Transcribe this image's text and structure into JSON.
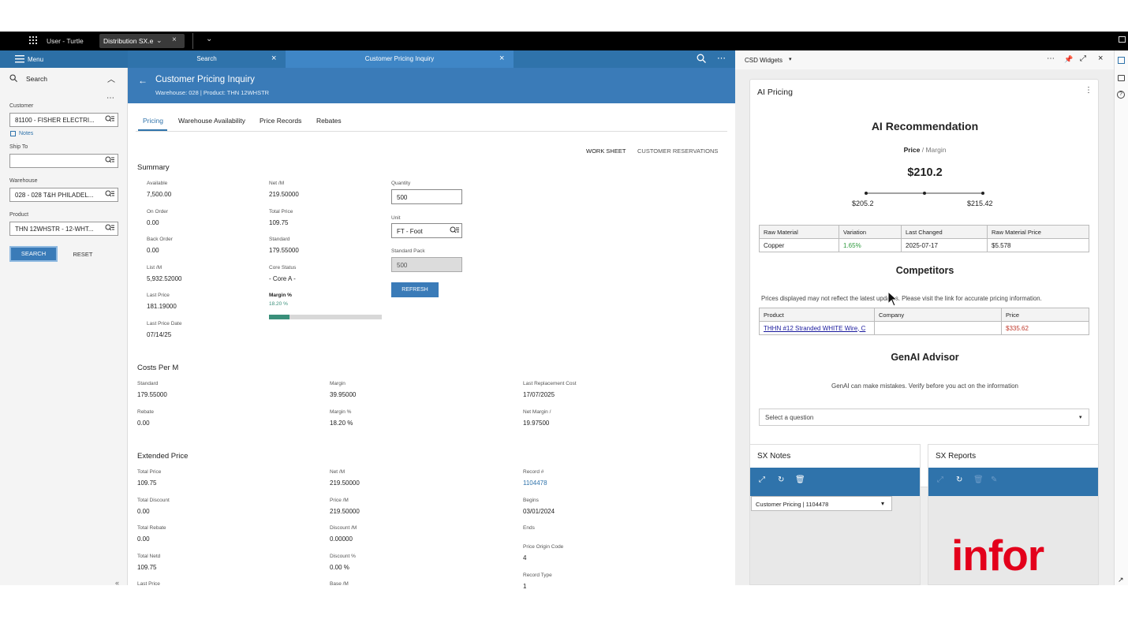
{
  "topbar": {
    "user": "User - Turtle",
    "app": "Distribution SX.e"
  },
  "menu": {
    "label": "Menu"
  },
  "tabs": [
    {
      "label": "Search"
    },
    {
      "label": "Customer Pricing Inquiry"
    }
  ],
  "search_panel": {
    "title": "Search",
    "customer_label": "Customer",
    "customer_value": "81100 - FISHER ELECTRI...",
    "notes_label": "Notes",
    "shipto_label": "Ship To",
    "shipto_value": "",
    "warehouse_label": "Warehouse",
    "warehouse_value": "028 - 028 T&H PHILADEL...",
    "product_label": "Product",
    "product_value": "THN 12WHSTR - 12-WHT...",
    "search_btn": "SEARCH",
    "reset_btn": "RESET"
  },
  "header": {
    "title": "Customer Pricing Inquiry",
    "subtitle": "Warehouse: 028 | Product: THN 12WHSTR"
  },
  "subtabs": [
    "Pricing",
    "Warehouse Availability",
    "Price Records",
    "Rebates"
  ],
  "actions": {
    "worksheet": "WORK SHEET",
    "reservations": "CUSTOMER RESERVATIONS"
  },
  "summary": {
    "title": "Summary",
    "available_label": "Available",
    "available": "7,500.00",
    "on_order_label": "On Order",
    "on_order": "0.00",
    "back_order_label": "Back Order",
    "back_order": "0.00",
    "list_label": "List /M",
    "list": "5,932.52000",
    "last_price_label": "Last Price",
    "last_price": "181.19000",
    "last_price_date_label": "Last Price Date",
    "last_price_date": "07/14/25",
    "net_label": "Net /M",
    "net": "219.50000",
    "total_price_label": "Total Price",
    "total_price": "109.75",
    "standard_label": "Standard",
    "standard": "179.55000",
    "core_status_label": "Core Status",
    "core_status": "- Core A -",
    "margin_label": "Margin %",
    "margin": "18.20 %",
    "margin_fraction": 0.182,
    "quantity_label": "Quantity",
    "quantity": "500",
    "unit_label": "Unit",
    "unit": "FT - Foot",
    "std_pack_label": "Standard Pack",
    "std_pack": "500",
    "refresh_btn": "REFRESH"
  },
  "costs": {
    "title": "Costs Per M",
    "standard_label": "Standard",
    "standard": "179.55000",
    "rebate_label": "Rebate",
    "rebate": "0.00",
    "margin_label": "Margin",
    "margin": "39.95000",
    "margin_pct_label": "Margin %",
    "margin_pct": "18.20 %",
    "last_repl_label": "Last Replacement Cost",
    "last_repl": "17/07/2025",
    "net_margin_label": "Net Margin /",
    "net_margin": "19.97500"
  },
  "extended": {
    "title": "Extended Price",
    "total_price_label": "Total Price",
    "total_price": "109.75",
    "total_discount_label": "Total Discount",
    "total_discount": "0.00",
    "total_rebate_label": "Total Rebate",
    "total_rebate": "0.00",
    "total_netd_label": "Total Netd",
    "total_netd": "109.75",
    "last_price_label": "Last Price",
    "net_label": "Net /M",
    "net": "219.50000",
    "price_label": "Price /M",
    "price": "219.50000",
    "discount_label": "Discount /M",
    "discount": "0.00000",
    "discount_pct_label": "Discount %",
    "discount_pct": "0.00 %",
    "base_label": "Base /M",
    "record_label": "Record #",
    "record": "1104478",
    "begins_label": "Begins",
    "begins": "03/01/2024",
    "ends_label": "Ends",
    "origin_label": "Price Origin Code",
    "origin": "4",
    "record_type_label": "Record Type",
    "record_type": "1"
  },
  "widgets": {
    "panel_title": "CSD Widgets",
    "ai_title": "AI Pricing",
    "ai_heading": "AI Recommendation",
    "price_word": "Price",
    "margin_word": "Margin",
    "recommended": "$210.2",
    "low": "$205.2",
    "high": "$215.42",
    "material_headers": [
      "Raw Material",
      "Variation",
      "Last Changed",
      "Raw Material Price"
    ],
    "material_row": [
      "Copper",
      "1.65%",
      "2025-07-17",
      "$5.578"
    ],
    "competitors_heading": "Competitors",
    "competitors_note": "Prices displayed may not reflect the latest updates. Please visit the link for accurate pricing information.",
    "comp_headers": [
      "Product",
      "Company",
      "Price"
    ],
    "comp_row": [
      "THHN #12 Stranded WHITE Wire, C",
      "",
      "$335.62"
    ],
    "genai_heading": "GenAI Advisor",
    "genai_note": "GenAI can make mistakes. Verify before you act on the information",
    "question_placeholder": "Select a question",
    "notes_title": "SX Notes",
    "notes_select": "Customer Pricing | 1104478",
    "reports_title": "SX Reports",
    "logo": "infor"
  },
  "colors": {
    "accent": "#2f73ab",
    "header": "#3a7bb8",
    "positive": "#2e9a3e",
    "negative": "#c0392b",
    "logo": "#e3001b"
  }
}
